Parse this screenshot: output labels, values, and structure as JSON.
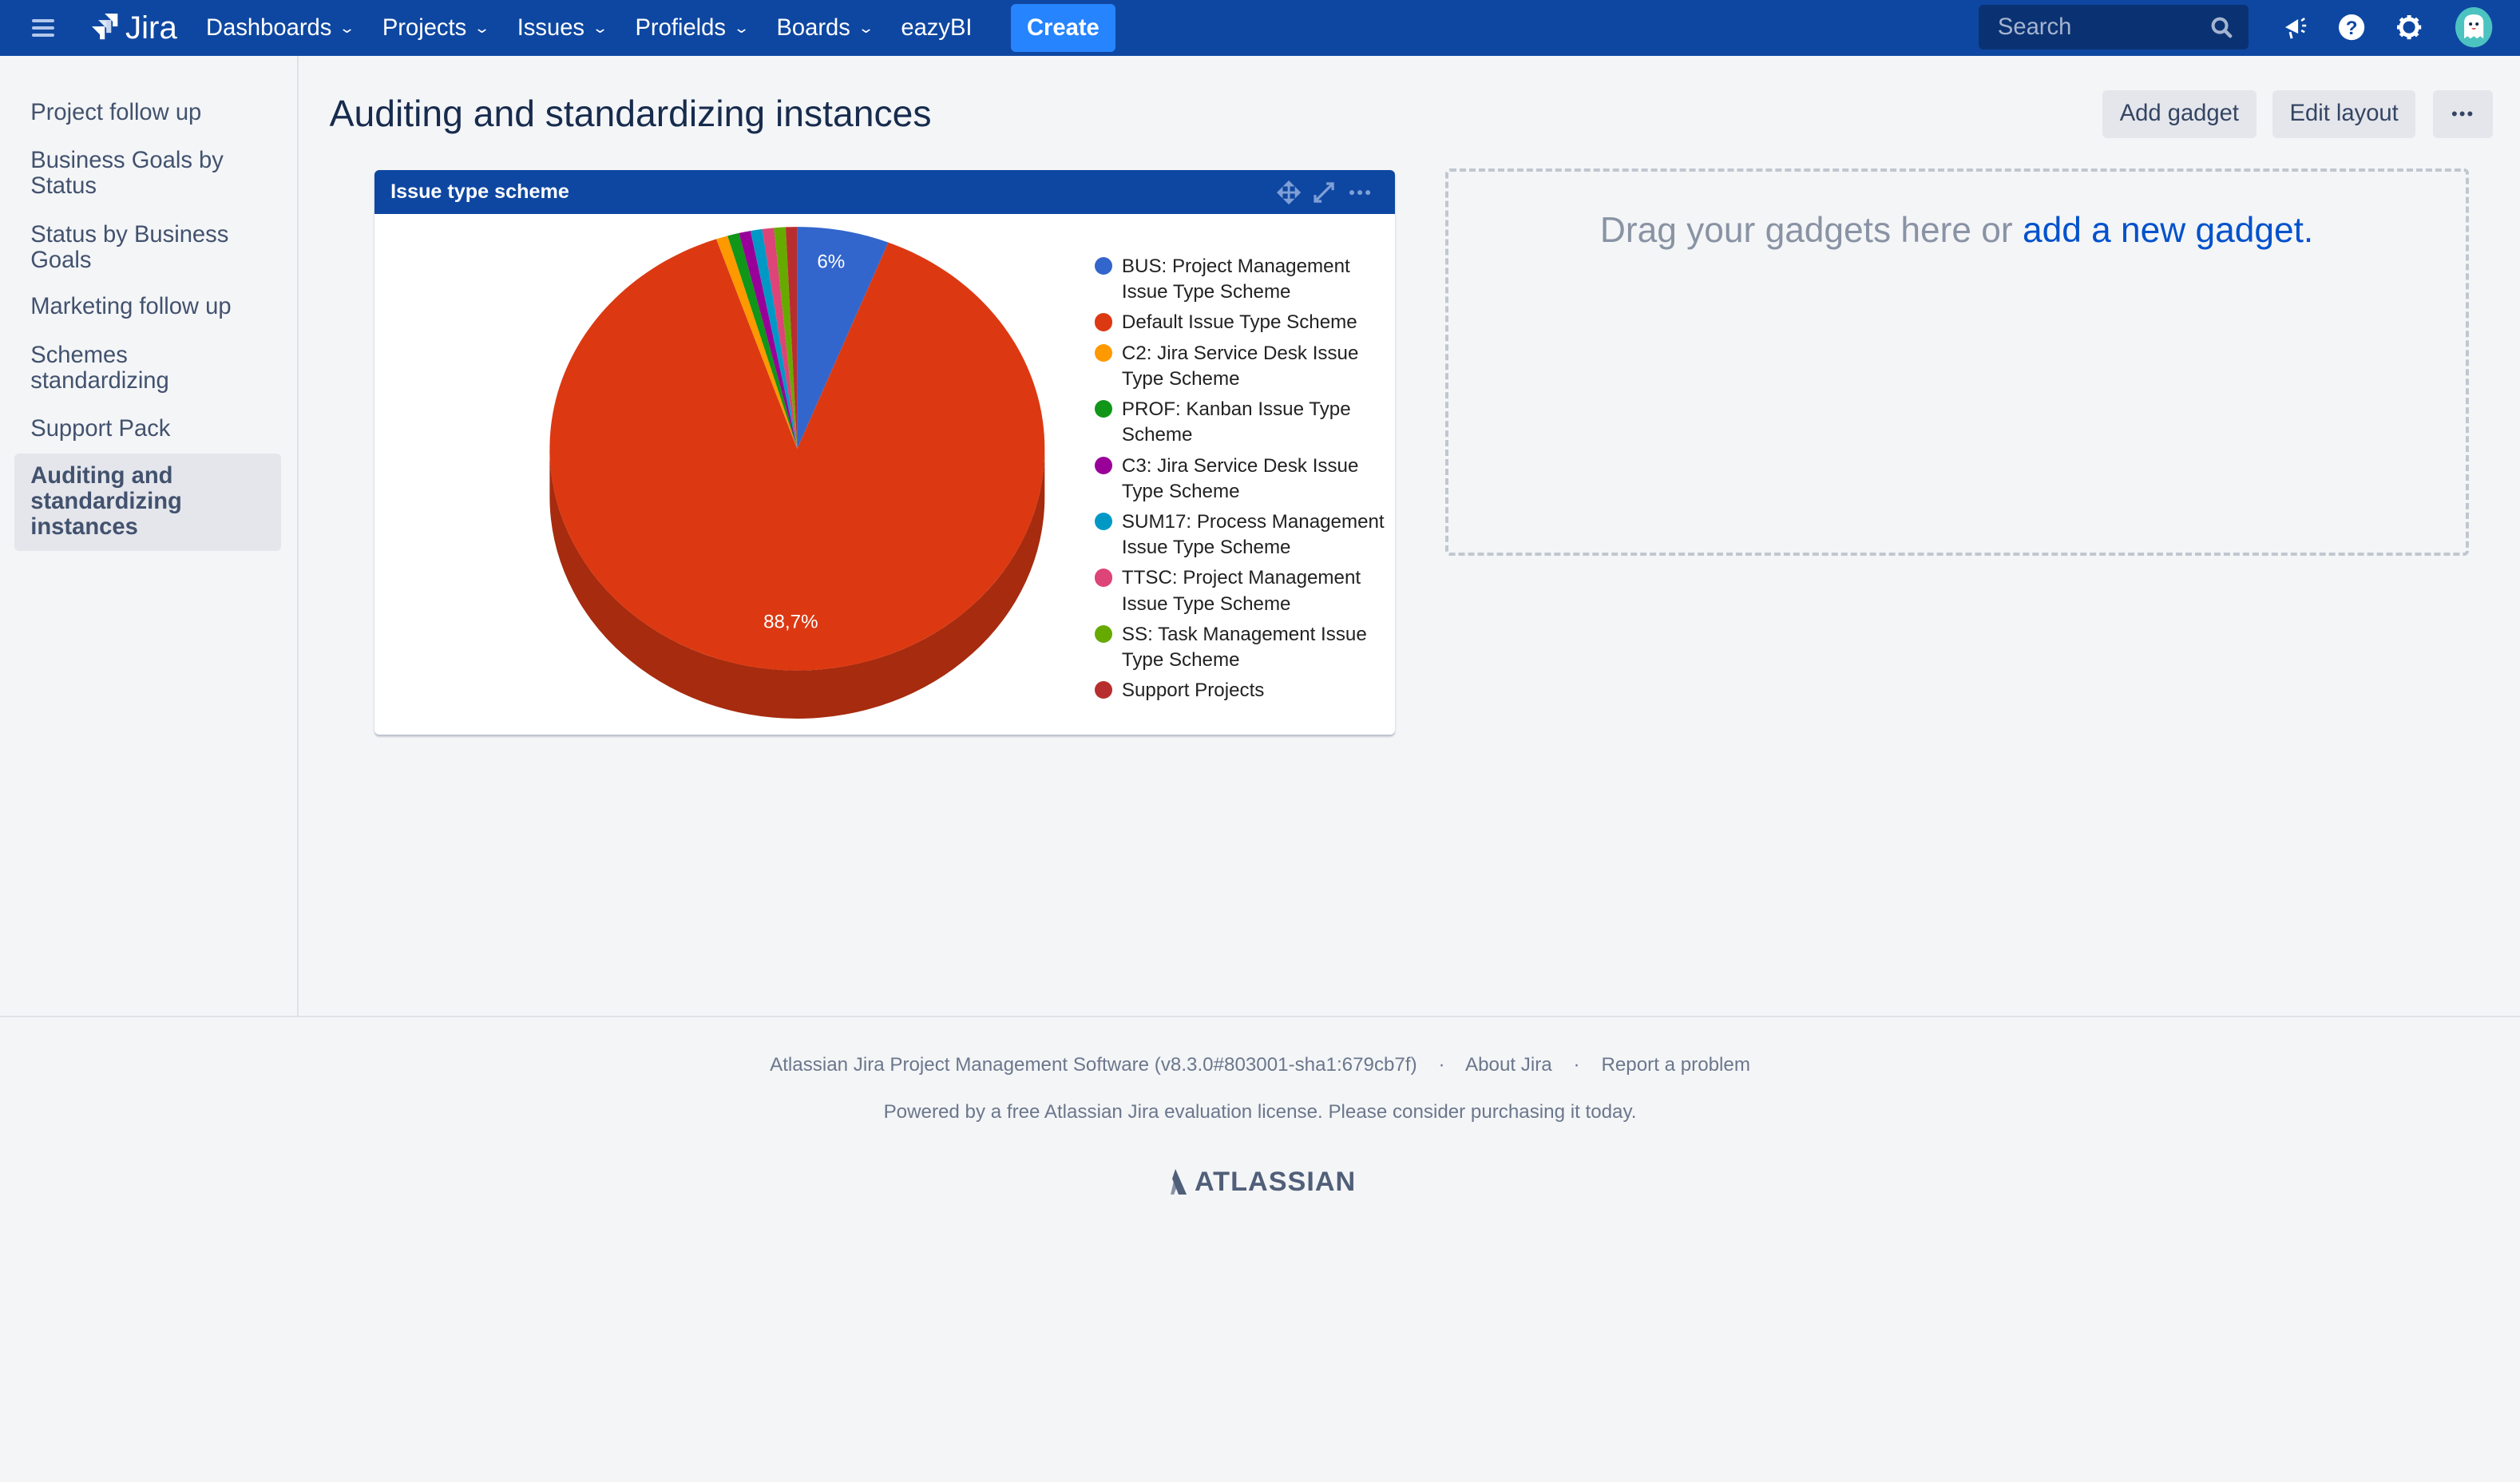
{
  "topnav": {
    "logo_text": "Jira",
    "items": [
      {
        "label": "Dashboards",
        "has_dropdown": true
      },
      {
        "label": "Projects",
        "has_dropdown": true
      },
      {
        "label": "Issues",
        "has_dropdown": true
      },
      {
        "label": "Profields",
        "has_dropdown": true
      },
      {
        "label": "Boards",
        "has_dropdown": true
      },
      {
        "label": "eazyBI",
        "has_dropdown": false
      }
    ],
    "create_label": "Create",
    "search_placeholder": "Search",
    "icons": [
      "notifications-icon",
      "help-icon",
      "settings-icon",
      "avatar"
    ],
    "colors": {
      "bar": "#0e47a1",
      "create": "#2684ff"
    }
  },
  "sidebar": {
    "items": [
      {
        "label": "Project follow up",
        "active": false
      },
      {
        "label": "Business Goals by Status",
        "active": false
      },
      {
        "label": "Status by Business Goals",
        "active": false
      },
      {
        "label": "Marketing follow up",
        "active": false
      },
      {
        "label": "Schemes standardizing",
        "active": false
      },
      {
        "label": "Support Pack",
        "active": false
      },
      {
        "label": "Auditing and standardizing instances",
        "active": true
      }
    ]
  },
  "page": {
    "title": "Auditing and standardizing instances",
    "add_gadget_label": "Add gadget",
    "edit_layout_label": "Edit layout",
    "more_label": "•••"
  },
  "gadget": {
    "title": "Issue type scheme"
  },
  "chart_data": {
    "type": "pie",
    "style": "3d",
    "title": "Issue type scheme",
    "legend_position": "right",
    "categories": [
      "BUS: Project Management Issue Type Scheme",
      "Default Issue Type Scheme",
      "C2: Jira Service Desk Issue Type Scheme",
      "PROF: Kanban Issue Type Scheme",
      "C3: Jira Service Desk Issue Type Scheme",
      "SUM17: Process Management Issue Type Scheme",
      "TTSC: Project Management Issue Type Scheme",
      "SS: Task Management Issue Type Scheme",
      "Support Projects"
    ],
    "values": [
      6.0,
      88.7,
      0.76,
      0.76,
      0.76,
      0.76,
      0.76,
      0.76,
      0.74
    ],
    "colors": [
      "#3366cc",
      "#dc3912",
      "#ff9900",
      "#109618",
      "#990099",
      "#0099c6",
      "#dd4477",
      "#66aa00",
      "#b82e2e"
    ],
    "data_labels": [
      "6%",
      "88,7%",
      "",
      "",
      "",
      "",
      "",
      "",
      ""
    ]
  },
  "dropzone": {
    "text": "Drag your gadgets here or ",
    "link": "add a new gadget."
  },
  "footer": {
    "version_text": "Atlassian Jira Project Management Software (v8.3.0#803001-sha1:679cb7f)",
    "about_label": "About Jira",
    "report_label": "Report a problem",
    "separator": "·",
    "license_text": "Powered by a free Atlassian Jira evaluation license. Please consider purchasing it today.",
    "brand": "ATLASSIAN"
  }
}
